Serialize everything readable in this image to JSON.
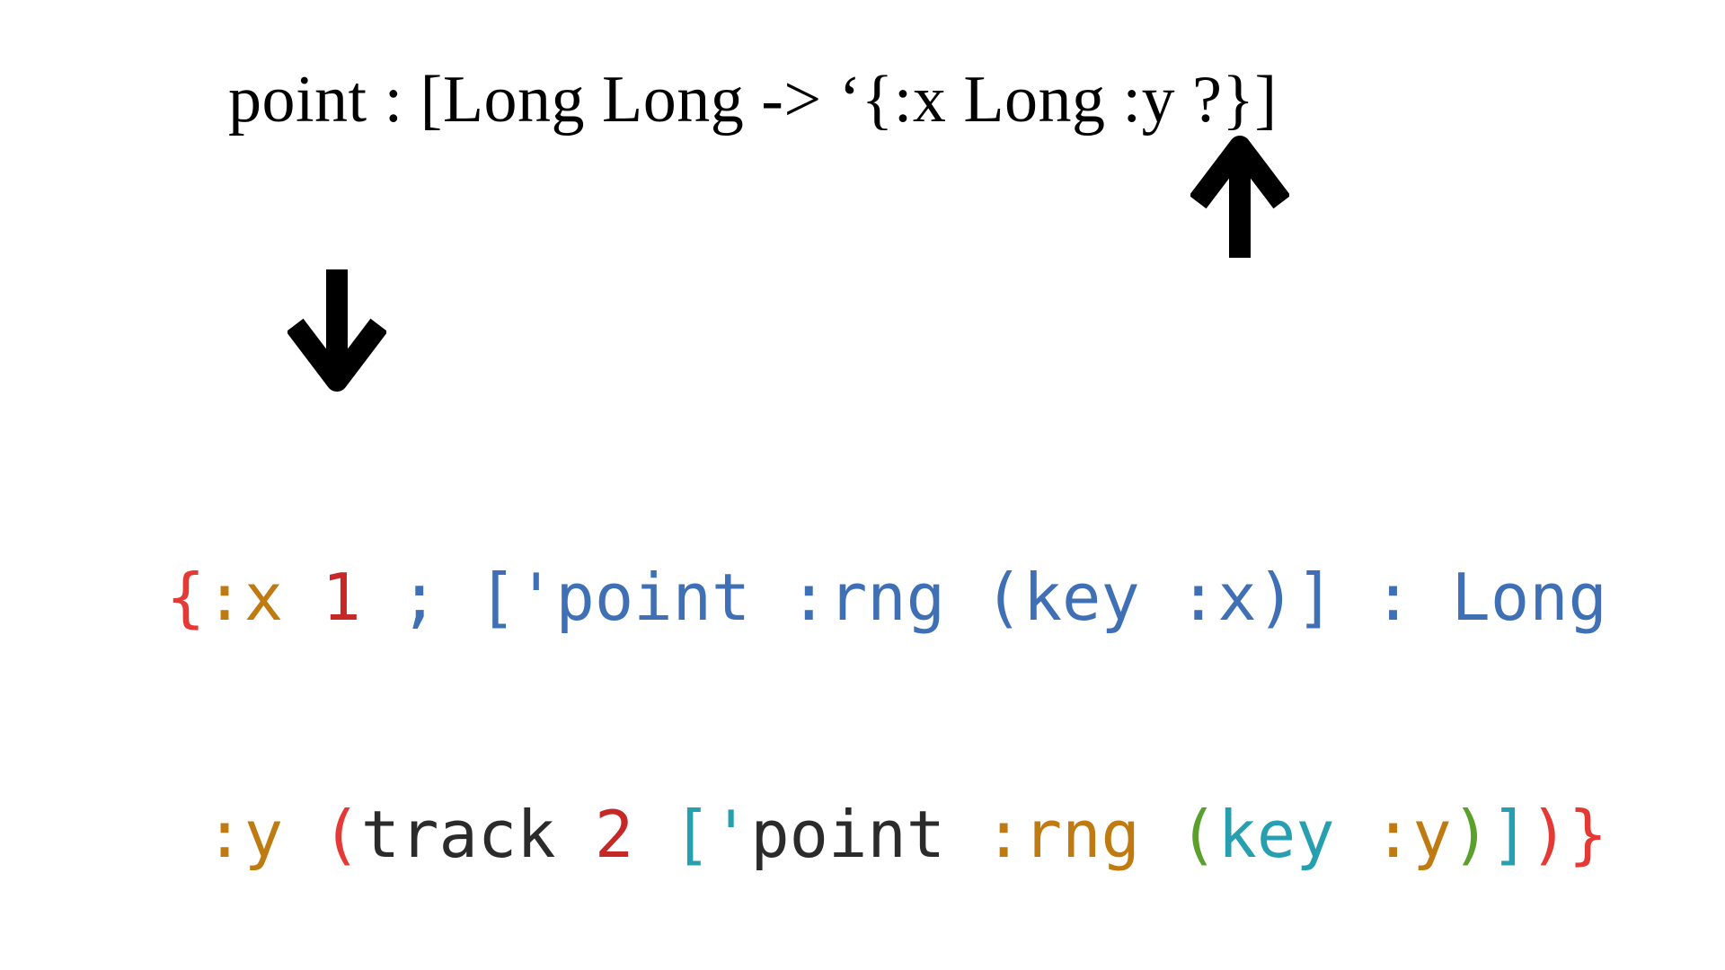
{
  "signature": {
    "text": "point : [Long Long -> ‘{:x Long :y ?}]"
  },
  "arrows": [
    {
      "name": "up-arrow-icon",
      "direction": "up"
    },
    {
      "name": "down-arrow-icon",
      "direction": "down"
    }
  ],
  "code": {
    "lines": [
      [
        {
          "text": "{",
          "color": "#e53935"
        },
        {
          "text": ":x",
          "color": "#c07a12"
        },
        {
          "text": " ",
          "color": "#000000"
        },
        {
          "text": "1",
          "color": "#c62828"
        },
        {
          "text": " ; [",
          "color": "#3f6fb5"
        },
        {
          "text": "'point :rng (key :x)] : Long",
          "color": "#3f6fb5"
        }
      ],
      [
        {
          "text": " ",
          "color": "#000000"
        },
        {
          "text": ":y",
          "color": "#c07a12"
        },
        {
          "text": " ",
          "color": "#000000"
        },
        {
          "text": "(",
          "color": "#e53935"
        },
        {
          "text": "track",
          "color": "#2b2b2b"
        },
        {
          "text": " ",
          "color": "#000000"
        },
        {
          "text": "2",
          "color": "#c62828"
        },
        {
          "text": " ",
          "color": "#000000"
        },
        {
          "text": "[",
          "color": "#26a0b0"
        },
        {
          "text": "'",
          "color": "#26a0b0"
        },
        {
          "text": "point",
          "color": "#2b2b2b"
        },
        {
          "text": " ",
          "color": "#000000"
        },
        {
          "text": ":rng",
          "color": "#c07a12"
        },
        {
          "text": " ",
          "color": "#000000"
        },
        {
          "text": "(",
          "color": "#5aa02c"
        },
        {
          "text": "key",
          "color": "#26a0b0"
        },
        {
          "text": " ",
          "color": "#000000"
        },
        {
          "text": ":y",
          "color": "#c07a12"
        },
        {
          "text": ")",
          "color": "#5aa02c"
        },
        {
          "text": "]",
          "color": "#26a0b0"
        },
        {
          "text": ")",
          "color": "#e53935"
        },
        {
          "text": "}",
          "color": "#e53935"
        }
      ]
    ]
  }
}
